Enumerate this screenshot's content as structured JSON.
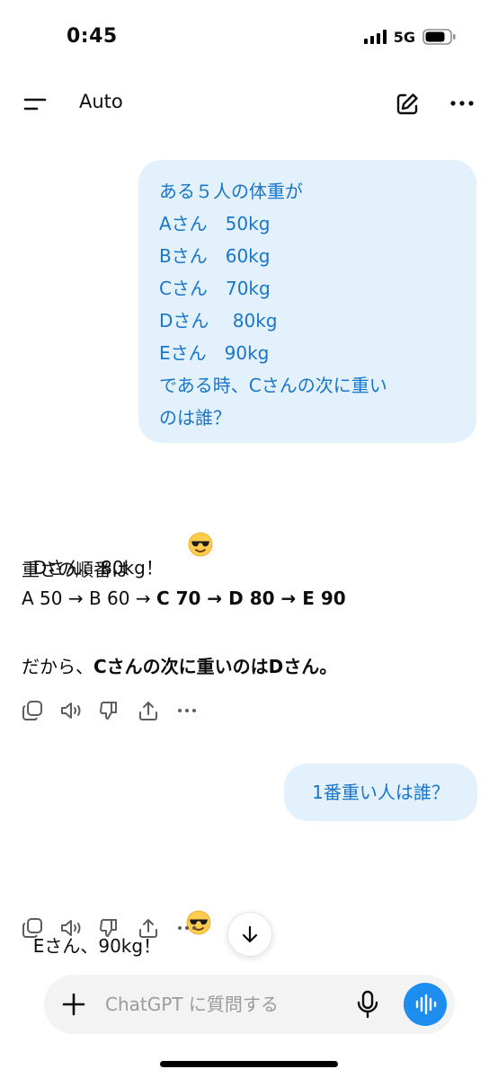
{
  "status_bar": {
    "time": "0:45",
    "network": "5G"
  },
  "header": {
    "model_label": "Auto"
  },
  "messages": [
    {
      "role": "user",
      "lines": [
        "ある５人の体重が",
        "Aさん　50kg",
        "Bさん　60kg",
        "Cさん　70kg",
        "Dさん　 80kg",
        "Eさん　90kg",
        "である時、Cさんの次に重い",
        "のは誰？"
      ]
    },
    {
      "role": "assistant",
      "answer": "Dさん、80kg！",
      "order_intro": "重さの順番は",
      "order_plain": "A 50 → B 60 → ",
      "order_bold": "C 70 → D 80 → E 90",
      "conclusion_prefix": "だから、",
      "conclusion_bold": "Cさんの次に重いのはDさん。"
    },
    {
      "role": "user",
      "text": "1番重い人は誰？"
    },
    {
      "role": "assistant",
      "answer": "Eさん、90kg！"
    }
  ],
  "icons": {
    "actions": [
      "copy-icon",
      "speaker-icon",
      "thumbs-down-icon",
      "share-icon",
      "more-icon"
    ],
    "emoji": "smiling-face-with-sunglasses",
    "accent": "#1d8ef0",
    "user_bubble_bg": "#e3f1fd",
    "user_text": "#1976c9"
  },
  "composer": {
    "placeholder": "ChatGPT に質問する"
  }
}
